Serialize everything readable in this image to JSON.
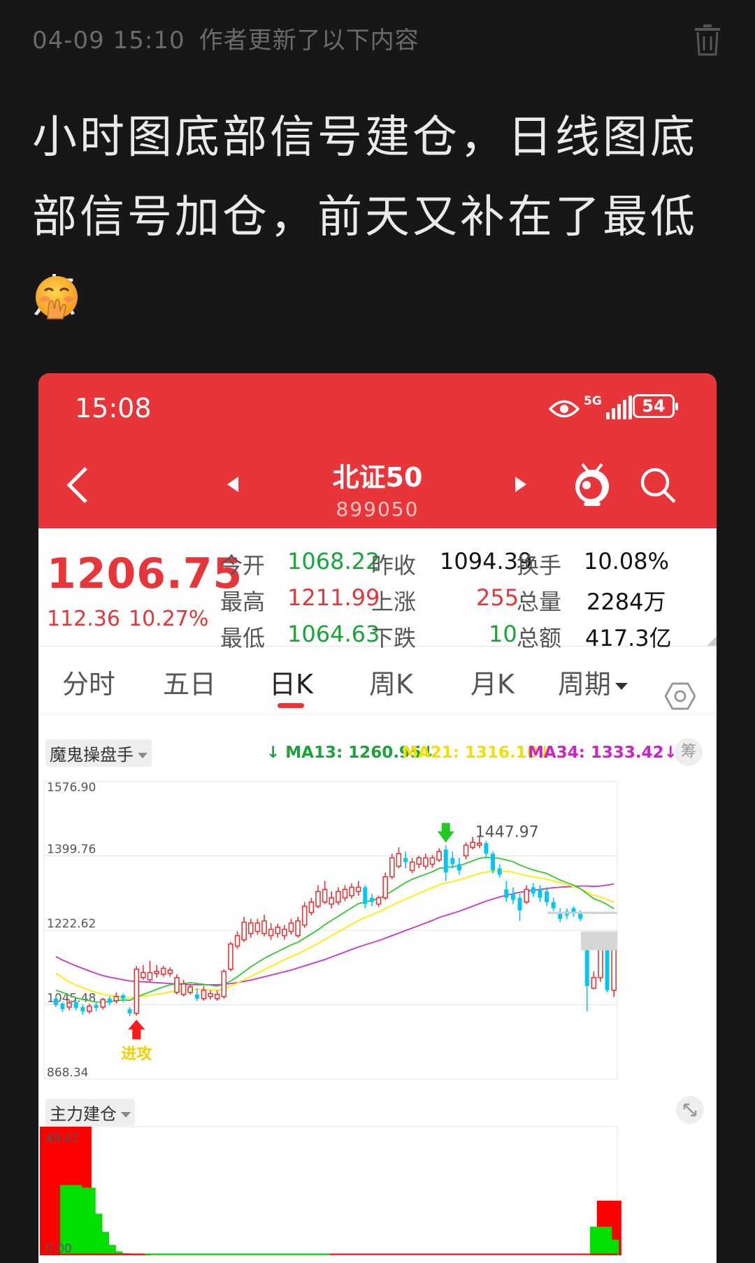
{
  "post": {
    "time": "04-09 15:10",
    "note": "作者更新了以下内容",
    "text": "小时图底部信号建仓，日线图底部信号加仓，前天又补在了最低点"
  },
  "status_bar": {
    "time": "15:08",
    "network": "5G",
    "battery": "54"
  },
  "stock": {
    "name": "北证50",
    "code": "899050",
    "price": "1206.75",
    "change": "112.36",
    "change_pct": "10.27%",
    "open_label": "今开",
    "open": "1068.22",
    "prev_close_label": "昨收",
    "prev_close": "1094.39",
    "turnover_label": "换手",
    "turnover": "10.08%",
    "high_label": "最高",
    "high": "1211.99",
    "up_label": "上涨",
    "up": "255",
    "volume_label": "总量",
    "volume": "2284万",
    "low_label": "最低",
    "low": "1064.63",
    "down_label": "下跌",
    "down": "10",
    "amount_label": "总额",
    "amount": "417.3亿"
  },
  "tabs": {
    "t1": "分时",
    "t2": "五日",
    "t3": "日K",
    "t4": "周K",
    "t5": "月K",
    "t6": "周期"
  },
  "indicators": {
    "main": "魔鬼操盘手",
    "ma13": "MA13: 1260.95",
    "ma21": "MA21: 1316.10",
    "ma34": "MA34: 1333.42",
    "chip_button": "筹",
    "sub": "主力建仓",
    "attack_label": "进攻"
  },
  "chart_data": [
    {
      "type": "candlestick",
      "y_ticks": [
        "1576.90",
        "1399.76",
        "1222.62",
        "1045.48",
        "868.34"
      ],
      "ylim": [
        868.34,
        1576.9
      ],
      "high_annotation": "1447.97",
      "colors": {
        "up": "#e8353a",
        "down": "#00c8f0",
        "ma13": "#33c933",
        "ma21": "#ffee00",
        "ma34": "#cc33cc"
      },
      "candles": [
        [
          1060,
          1045,
          1068,
          1040
        ],
        [
          1048,
          1035,
          1052,
          1028
        ],
        [
          1040,
          1050,
          1058,
          1032
        ],
        [
          1052,
          1038,
          1056,
          1032
        ],
        [
          1040,
          1030,
          1046,
          1022
        ],
        [
          1030,
          1042,
          1048,
          1024
        ],
        [
          1045,
          1038,
          1050,
          1030
        ],
        [
          1040,
          1058,
          1062,
          1034
        ],
        [
          1060,
          1050,
          1066,
          1044
        ],
        [
          1055,
          1065,
          1075,
          1048
        ],
        [
          1068,
          1060,
          1072,
          1052
        ],
        [
          1035,
          1025,
          1040,
          1018
        ],
        [
          1025,
          1130,
          1138,
          1020
        ],
        [
          1110,
          1122,
          1140,
          1105
        ],
        [
          1105,
          1122,
          1150,
          1100
        ],
        [
          1120,
          1125,
          1140,
          1110
        ],
        [
          1118,
          1132,
          1138,
          1112
        ],
        [
          1120,
          1128,
          1135,
          1112
        ],
        [
          1075,
          1110,
          1118,
          1070
        ],
        [
          1070,
          1095,
          1105,
          1065
        ],
        [
          1075,
          1088,
          1095,
          1070
        ],
        [
          1070,
          1060,
          1085,
          1055
        ],
        [
          1060,
          1080,
          1090,
          1055
        ],
        [
          1065,
          1072,
          1080,
          1058
        ],
        [
          1060,
          1070,
          1080,
          1055
        ],
        [
          1065,
          1125,
          1130,
          1060
        ],
        [
          1130,
          1190,
          1195,
          1125
        ],
        [
          1185,
          1210,
          1220,
          1178
        ],
        [
          1200,
          1242,
          1255,
          1195
        ],
        [
          1215,
          1240,
          1250,
          1205
        ],
        [
          1220,
          1240,
          1250,
          1212
        ],
        [
          1215,
          1245,
          1260,
          1208
        ],
        [
          1210,
          1225,
          1240,
          1200
        ],
        [
          1215,
          1230,
          1238,
          1205
        ],
        [
          1210,
          1225,
          1235,
          1200
        ],
        [
          1220,
          1240,
          1250,
          1212
        ],
        [
          1210,
          1245,
          1255,
          1205
        ],
        [
          1235,
          1280,
          1290,
          1228
        ],
        [
          1265,
          1290,
          1300,
          1258
        ],
        [
          1280,
          1315,
          1330,
          1275
        ],
        [
          1290,
          1320,
          1340,
          1285
        ],
        [
          1285,
          1300,
          1315,
          1275
        ],
        [
          1290,
          1315,
          1325,
          1283
        ],
        [
          1300,
          1320,
          1330,
          1292
        ],
        [
          1305,
          1325,
          1335,
          1298
        ],
        [
          1315,
          1325,
          1340,
          1305
        ],
        [
          1325,
          1285,
          1330,
          1275
        ],
        [
          1300,
          1290,
          1310,
          1280
        ],
        [
          1285,
          1300,
          1305,
          1278
        ],
        [
          1300,
          1350,
          1360,
          1295
        ],
        [
          1350,
          1395,
          1405,
          1345
        ],
        [
          1375,
          1405,
          1420,
          1370
        ],
        [
          1395,
          1385,
          1410,
          1370
        ],
        [
          1365,
          1385,
          1395,
          1358
        ],
        [
          1380,
          1395,
          1400,
          1370
        ],
        [
          1375,
          1395,
          1405,
          1368
        ],
        [
          1380,
          1395,
          1402,
          1372
        ],
        [
          1390,
          1410,
          1418,
          1385
        ],
        [
          1415,
          1360,
          1425,
          1340
        ],
        [
          1395,
          1380,
          1410,
          1370
        ],
        [
          1380,
          1365,
          1395,
          1355
        ],
        [
          1400,
          1425,
          1432,
          1392
        ],
        [
          1420,
          1432,
          1445,
          1415
        ],
        [
          1425,
          1430,
          1448,
          1418
        ],
        [
          1430,
          1405,
          1435,
          1395
        ],
        [
          1405,
          1365,
          1410,
          1358
        ],
        [
          1370,
          1355,
          1380,
          1348
        ],
        [
          1320,
          1300,
          1340,
          1290
        ],
        [
          1310,
          1295,
          1325,
          1285
        ],
        [
          1300,
          1270,
          1310,
          1245
        ],
        [
          1290,
          1320,
          1330,
          1285
        ],
        [
          1325,
          1310,
          1335,
          1302
        ],
        [
          1320,
          1300,
          1330,
          1290
        ],
        [
          1315,
          1290,
          1325,
          1280
        ],
        [
          1290,
          1275,
          1300,
          1268
        ],
        [
          1265,
          1250,
          1275,
          1242
        ],
        [
          1268,
          1258,
          1275,
          1250
        ],
        [
          1275,
          1262,
          1280,
          1255
        ],
        [
          1265,
          1250,
          1270,
          1245
        ],
        [
          1180,
          1090,
          1190,
          1030
        ],
        [
          1085,
          1110,
          1125,
          1082
        ],
        [
          1110,
          1190,
          1200,
          1100
        ],
        [
          1190,
          1080,
          1200,
          1075
        ],
        [
          1080,
          1206,
          1212,
          1064
        ]
      ],
      "ma13": [
        1080,
        1075,
        1068,
        1062,
        1058,
        1055,
        1052,
        1052,
        1053,
        1055,
        1057,
        1056,
        1064,
        1070,
        1076,
        1082,
        1088,
        1093,
        1095,
        1096,
        1098,
        1096,
        1094,
        1092,
        1090,
        1094,
        1102,
        1112,
        1124,
        1136,
        1146,
        1156,
        1164,
        1172,
        1180,
        1188,
        1194,
        1204,
        1214,
        1224,
        1236,
        1246,
        1256,
        1266,
        1276,
        1286,
        1290,
        1294,
        1298,
        1306,
        1316,
        1326,
        1336,
        1344,
        1350,
        1356,
        1362,
        1370,
        1372,
        1374,
        1376,
        1382,
        1388,
        1394,
        1396,
        1396,
        1394,
        1390,
        1386,
        1378,
        1372,
        1366,
        1362,
        1358,
        1350,
        1342,
        1336,
        1330,
        1322,
        1310,
        1298,
        1292,
        1284,
        1274
      ],
      "ma21": [
        1120,
        1110,
        1100,
        1092,
        1086,
        1080,
        1075,
        1071,
        1068,
        1066,
        1064,
        1062,
        1064,
        1066,
        1068,
        1070,
        1073,
        1076,
        1078,
        1080,
        1082,
        1082,
        1082,
        1081,
        1080,
        1084,
        1090,
        1097,
        1105,
        1113,
        1121,
        1129,
        1137,
        1145,
        1153,
        1160,
        1167,
        1175,
        1183,
        1192,
        1201,
        1210,
        1219,
        1228,
        1237,
        1246,
        1253,
        1260,
        1266,
        1274,
        1282,
        1290,
        1297,
        1304,
        1311,
        1318,
        1324,
        1331,
        1335,
        1339,
        1343,
        1348,
        1353,
        1358,
        1361,
        1363,
        1364,
        1363,
        1361,
        1357,
        1353,
        1350,
        1347,
        1344,
        1340,
        1336,
        1331,
        1327,
        1322,
        1314,
        1306,
        1302,
        1296,
        1289
      ],
      "ma34": [
        1160,
        1152,
        1145,
        1138,
        1132,
        1126,
        1120,
        1115,
        1111,
        1108,
        1105,
        1102,
        1101,
        1100,
        1099,
        1098,
        1097,
        1096,
        1095,
        1094,
        1093,
        1093,
        1093,
        1093,
        1093,
        1094,
        1096,
        1098,
        1101,
        1104,
        1108,
        1112,
        1116,
        1120,
        1124,
        1128,
        1133,
        1138,
        1143,
        1148,
        1153,
        1159,
        1165,
        1171,
        1177,
        1183,
        1188,
        1193,
        1198,
        1204,
        1210,
        1216,
        1222,
        1228,
        1234,
        1240,
        1246,
        1253,
        1258,
        1263,
        1268,
        1274,
        1280,
        1286,
        1292,
        1297,
        1302,
        1306,
        1310,
        1313,
        1316,
        1318,
        1320,
        1322,
        1324,
        1325,
        1326,
        1327,
        1328,
        1328,
        1327,
        1328,
        1330,
        1333
      ]
    },
    {
      "type": "bar",
      "y_ticks": [
        "49.42",
        "0.00"
      ],
      "ylim": [
        0,
        49.42
      ],
      "series": [
        {
          "color": "#ff0000",
          "values": [
            49.42,
            49.42,
            42,
            49.42,
            49.42,
            8,
            0,
            0,
            0,
            0,
            0,
            0,
            0,
            0,
            0,
            0,
            0,
            0,
            0,
            0,
            0,
            0,
            0,
            0,
            0,
            0,
            0,
            0,
            0,
            0,
            0,
            0,
            0,
            0,
            0,
            0,
            0,
            0,
            0,
            0,
            0,
            0,
            0,
            0,
            0,
            0,
            0,
            0,
            0,
            0,
            0,
            0,
            0,
            0,
            0,
            0,
            0,
            0,
            0,
            0,
            0,
            0,
            0,
            0,
            0,
            0,
            0,
            0,
            0,
            0,
            0,
            0,
            0,
            0,
            0,
            0,
            0,
            0,
            0,
            0,
            0,
            0,
            21,
            0,
            0
          ]
        },
        {
          "color": "#00e000",
          "values": [
            0,
            0,
            0,
            27,
            0,
            26,
            16,
            9,
            4,
            1.5,
            0.8,
            0.5,
            0.3,
            0.2,
            0,
            0,
            0,
            0,
            0,
            0,
            0,
            0,
            0,
            0,
            0,
            0,
            0,
            0,
            0,
            0,
            0,
            0,
            0,
            0,
            0,
            0,
            0,
            0,
            0,
            0,
            0,
            0,
            0,
            0,
            0,
            0,
            0,
            0,
            0,
            0,
            0,
            0,
            0,
            0,
            0,
            0,
            0,
            0,
            0,
            0,
            0,
            0,
            0,
            0,
            0,
            0,
            0,
            0,
            0,
            0,
            0,
            0,
            0,
            0,
            0,
            0,
            0,
            0,
            0,
            0,
            0,
            11,
            6,
            0
          ]
        }
      ]
    }
  ]
}
